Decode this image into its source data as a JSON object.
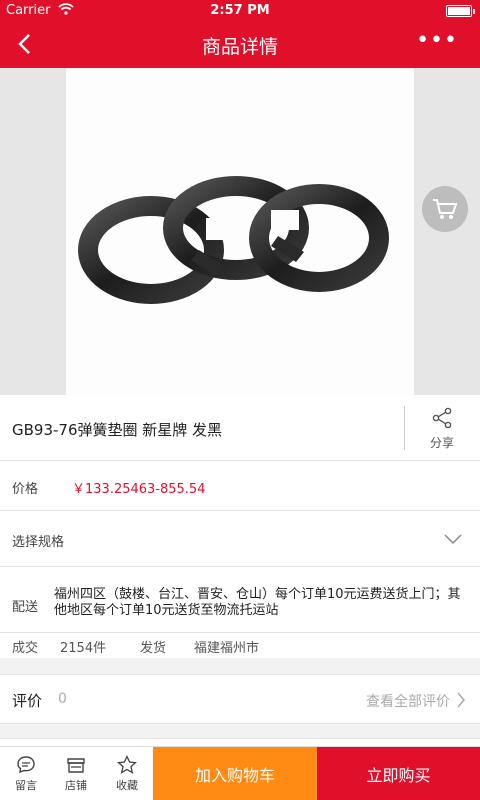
{
  "status_bar": {
    "carrier": "Carrier",
    "time": "2:57 PM"
  },
  "nav": {
    "title": "商品详情",
    "more": "•••",
    "back_icon": "chevron-left-icon"
  },
  "product": {
    "name": "GB93-76弹簧垫圈 新星牌 发黑",
    "share_label": "分享",
    "price_label": "价格",
    "price": "￥133.25463-855.54",
    "spec_label": "选择规格",
    "delivery_label": "配送",
    "delivery_text": "福州四区（鼓楼、台江、晋安、仓山）每个订单10元运费送货上门；其他地区每个订单10元送货至物流托运站",
    "deal_label": "成交",
    "deal_count": "2154件",
    "ship_label": "发货",
    "ship_from": "福建福州市"
  },
  "reviews": {
    "label": "评价",
    "count": "0",
    "view_all": "查看全部评价"
  },
  "bottom": {
    "message": "留言",
    "shop": "店铺",
    "favorite": "收藏",
    "add_to_cart": "加入购物车",
    "buy_now": "立即购买"
  },
  "colors": {
    "brand_red": "#e0102a",
    "cart_orange": "#ff8a14",
    "price_red": "#e0102a"
  }
}
